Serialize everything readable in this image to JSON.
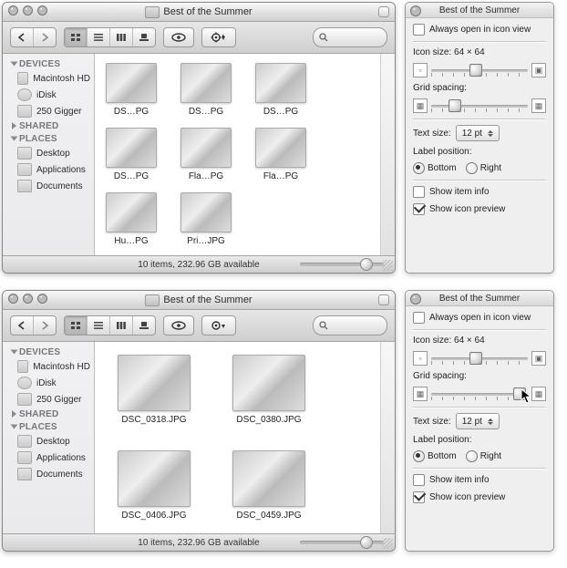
{
  "window": {
    "title": "Best of the Summer",
    "status_line": "10 items, 232.96 GB available"
  },
  "sidebar": {
    "sections": [
      {
        "label": "DEVICES",
        "items": [
          {
            "label": "Macintosh HD",
            "ic": "disk"
          },
          {
            "label": "iDisk",
            "ic": "sphere"
          },
          {
            "label": "250 Gigger",
            "ic": "disk"
          }
        ]
      },
      {
        "label": "SHARED",
        "items": []
      },
      {
        "label": "PLACES",
        "items": [
          {
            "label": "Desktop",
            "ic": "disk"
          },
          {
            "label": "Applications",
            "ic": "app"
          },
          {
            "label": "Documents",
            "ic": "docs"
          }
        ]
      }
    ]
  },
  "panes": {
    "top": {
      "files": [
        {
          "label": "DS…PG"
        },
        {
          "label": "DS…PG"
        },
        {
          "label": "DS…PG"
        },
        {
          "label": "DS…PG"
        },
        {
          "label": "Fla…PG"
        },
        {
          "label": "Fla…PG"
        },
        {
          "label": "Hu…PG"
        },
        {
          "label": "Pri…JPG"
        }
      ]
    },
    "bottom": {
      "files": [
        {
          "label": "DSC_0318.JPG"
        },
        {
          "label": "DSC_0380.JPG"
        },
        {
          "label": "DSC_0406.JPG"
        },
        {
          "label": "DSC_0459.JPG"
        }
      ]
    }
  },
  "inspector": {
    "title": "Best of the Summer",
    "always_open_label": "Always open in icon view",
    "always_open_checked": false,
    "icon_size_label": "Icon size: 64 × 64",
    "grid_spacing_label": "Grid spacing:",
    "text_size_label": "Text size:",
    "text_size_value": "12 pt",
    "label_pos_label": "Label position:",
    "label_bottom": "Bottom",
    "label_right": "Right",
    "show_item_info_label": "Show item info",
    "show_item_info_checked": false,
    "show_icon_preview_label": "Show icon preview",
    "show_icon_preview_checked": true,
    "icon_slider_pos_pct": 40,
    "grid_slider_top_pct": 18,
    "grid_slider_bottom_pct": 85
  }
}
